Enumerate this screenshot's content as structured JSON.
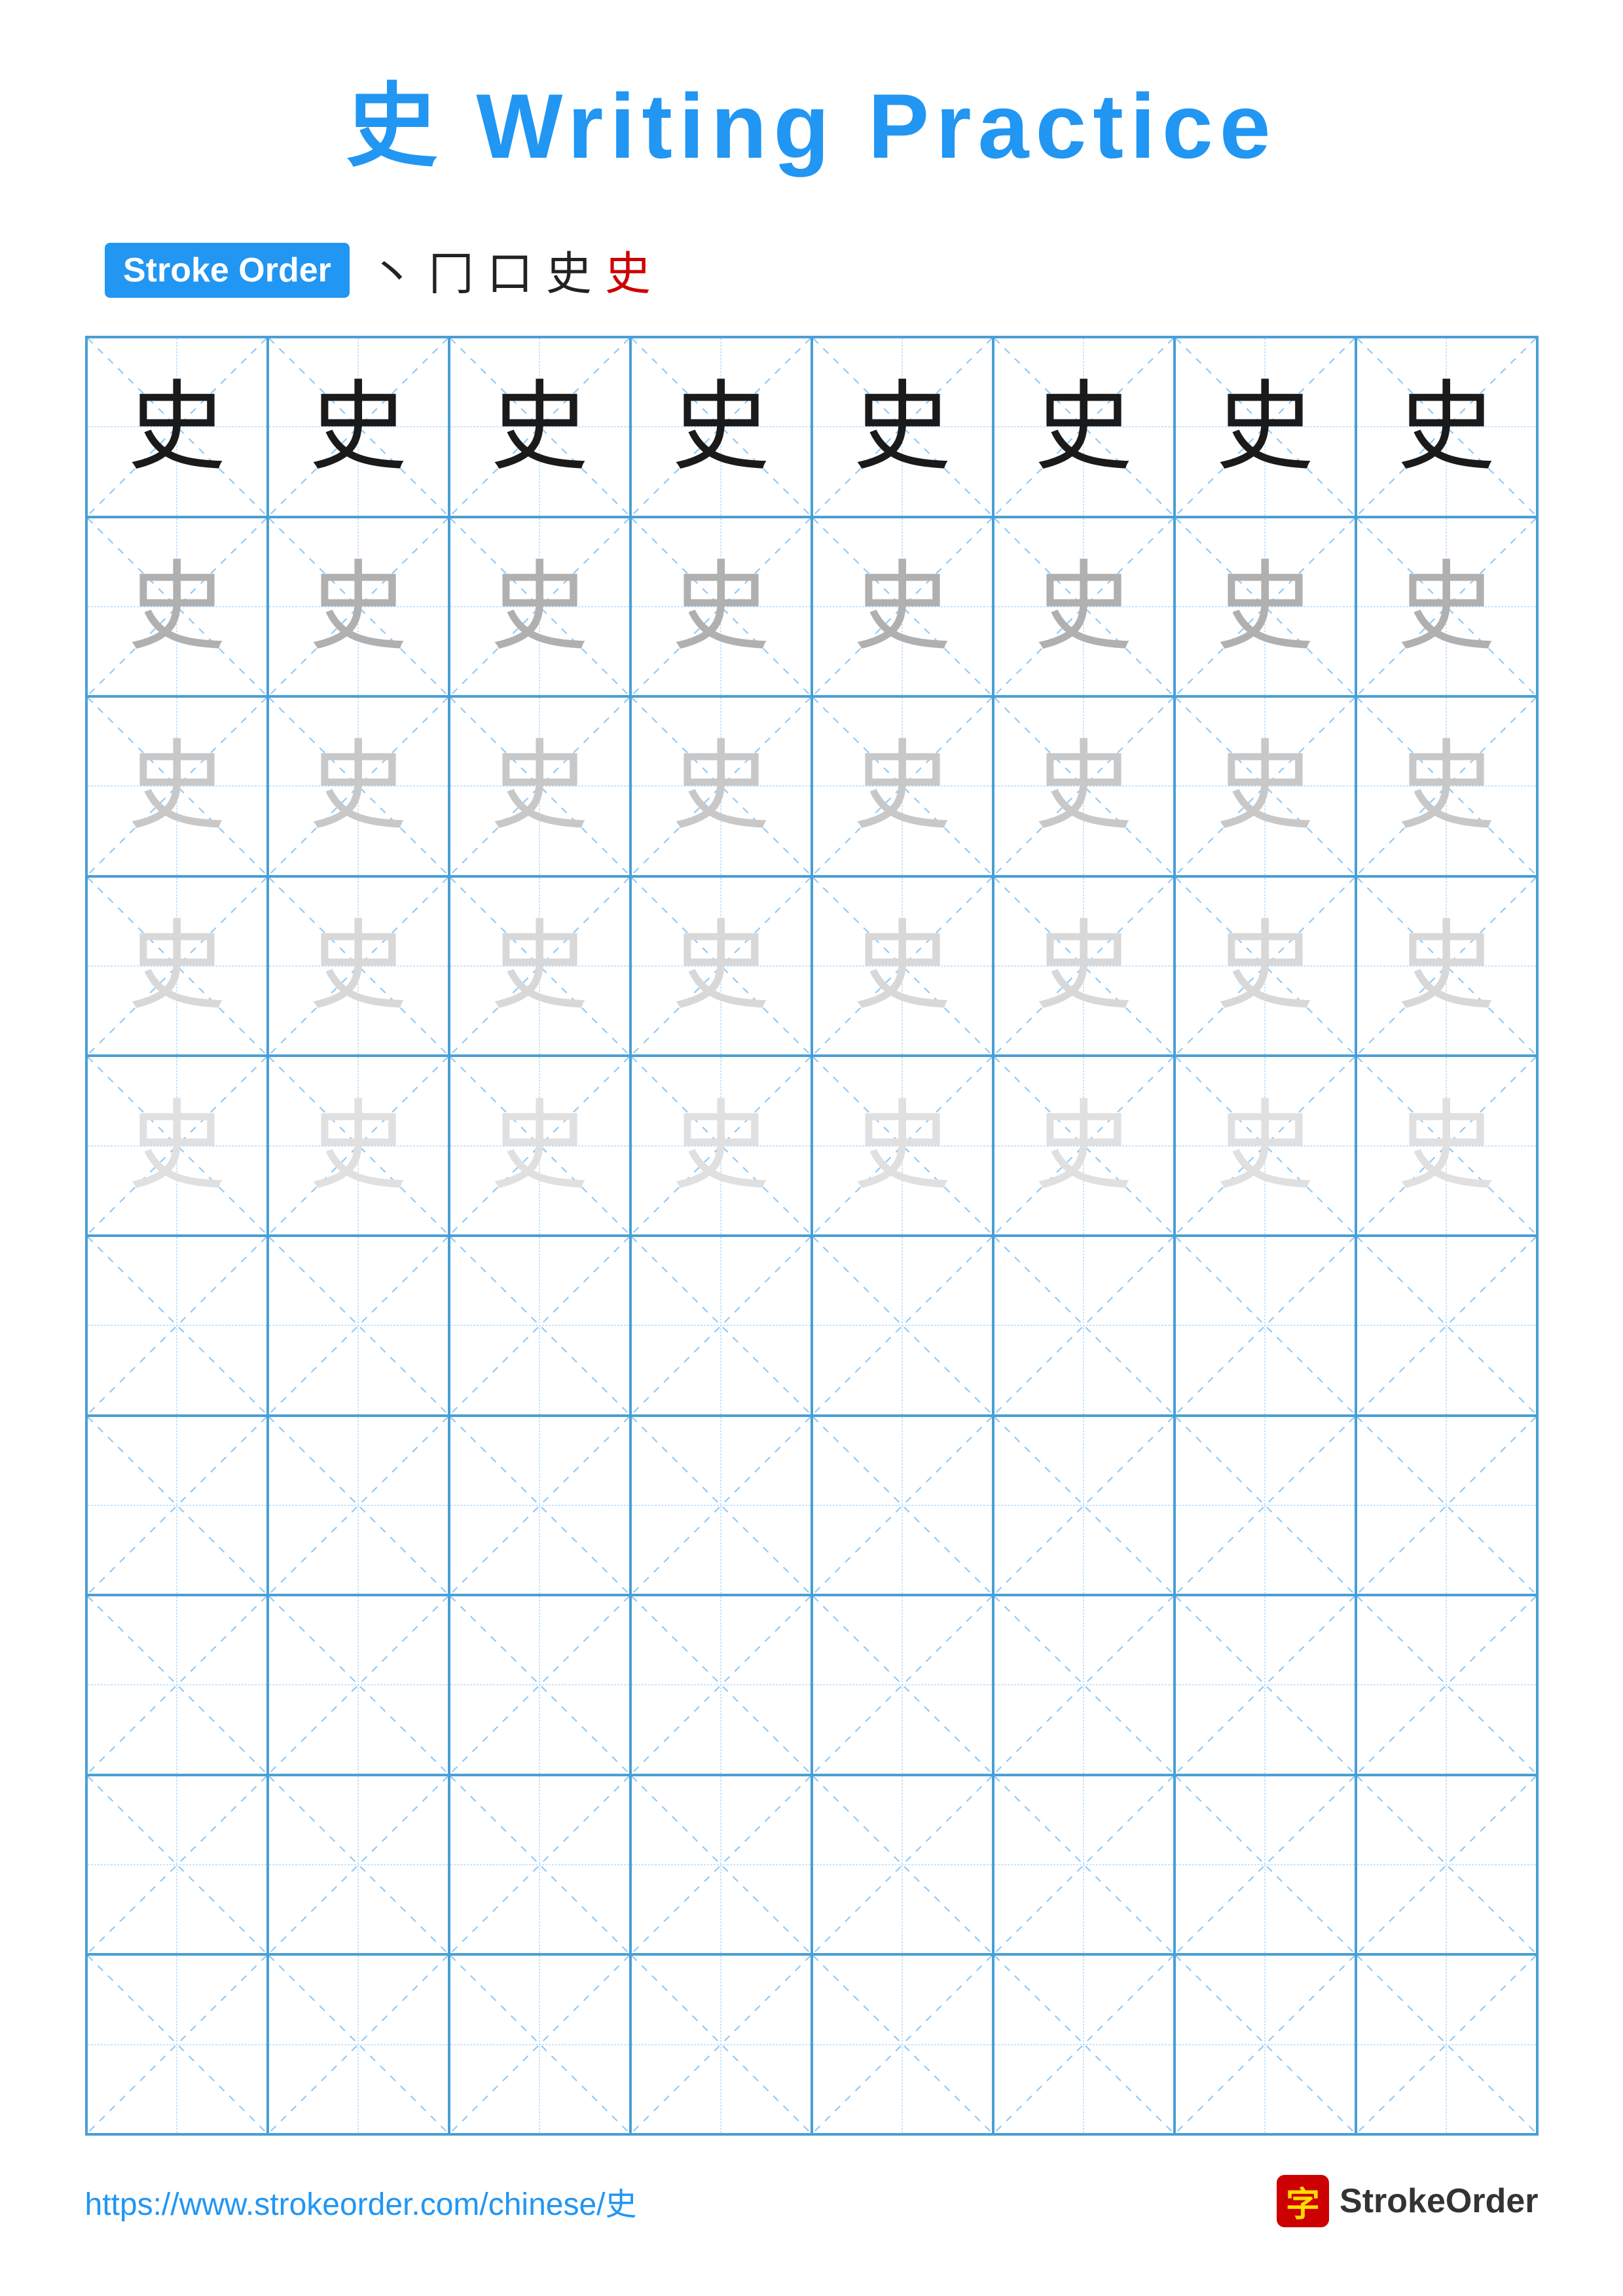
{
  "title": "史 Writing Practice",
  "stroke_order": {
    "badge_label": "Stroke Order",
    "strokes": [
      "丶",
      "冂",
      "口",
      "史",
      "史"
    ]
  },
  "character": "史",
  "grid": {
    "rows": 10,
    "cols": 8
  },
  "practice_rows": [
    {
      "shade": "dark",
      "chars": [
        "史",
        "史",
        "史",
        "史",
        "史",
        "史",
        "史",
        "史"
      ]
    },
    {
      "shade": "gray_dark",
      "chars": [
        "史",
        "史",
        "史",
        "史",
        "史",
        "史",
        "史",
        "史"
      ]
    },
    {
      "shade": "gray_medium",
      "chars": [
        "史",
        "史",
        "史",
        "史",
        "史",
        "史",
        "史",
        "史"
      ]
    },
    {
      "shade": "gray_light",
      "chars": [
        "史",
        "史",
        "史",
        "史",
        "史",
        "史",
        "史",
        "史"
      ]
    },
    {
      "shade": "gray_vlight",
      "chars": [
        "史",
        "史",
        "史",
        "史",
        "史",
        "史",
        "史",
        "史"
      ]
    },
    {
      "shade": "empty",
      "chars": [
        "",
        "",
        "",
        "",
        "",
        "",
        "",
        ""
      ]
    },
    {
      "shade": "empty",
      "chars": [
        "",
        "",
        "",
        "",
        "",
        "",
        "",
        ""
      ]
    },
    {
      "shade": "empty",
      "chars": [
        "",
        "",
        "",
        "",
        "",
        "",
        "",
        ""
      ]
    },
    {
      "shade": "empty",
      "chars": [
        "",
        "",
        "",
        "",
        "",
        "",
        "",
        ""
      ]
    },
    {
      "shade": "empty",
      "chars": [
        "",
        "",
        "",
        "",
        "",
        "",
        "",
        ""
      ]
    }
  ],
  "footer": {
    "url": "https://www.strokeorder.com/chinese/史",
    "logo_char": "字",
    "logo_text": "StrokeOrder"
  }
}
